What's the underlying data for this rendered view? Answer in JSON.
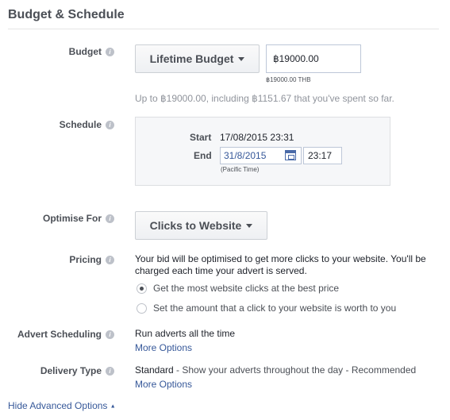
{
  "section": {
    "title": "Budget & Schedule"
  },
  "budget": {
    "label": "Budget",
    "type_button": "Lifetime Budget",
    "amount_value": "฿19000.00",
    "amount_note": "฿19000.00 THB",
    "summary": "Up to ฿19000.00, including ฿1151.67 that you've spent so far."
  },
  "schedule": {
    "label": "Schedule",
    "start_label": "Start",
    "start_value": "17/08/2015 23:31",
    "end_label": "End",
    "end_date": "31/8/2015",
    "end_time": "23:17",
    "timezone": "(Pacific Time)"
  },
  "optimise": {
    "label": "Optimise For",
    "value": "Clicks to Website"
  },
  "pricing": {
    "label": "Pricing",
    "description_line1": "Your bid will be optimised to get more clicks to your website. You'll be",
    "description_line2": "charged each time your advert is served.",
    "options": [
      {
        "label": "Get the most website clicks at the best price",
        "checked": true
      },
      {
        "label": "Set the amount that a click to your website is worth to you",
        "checked": false
      }
    ]
  },
  "advert_scheduling": {
    "label": "Advert Scheduling",
    "value": "Run adverts all the time",
    "more": "More Options"
  },
  "delivery": {
    "label": "Delivery Type",
    "value_strong": "Standard",
    "value_rest": " - Show your adverts throughout the day - Recommended",
    "more": "More Options"
  },
  "footer": {
    "hide_advanced": "Hide Advanced Options"
  },
  "info_icon_glyph": "i"
}
